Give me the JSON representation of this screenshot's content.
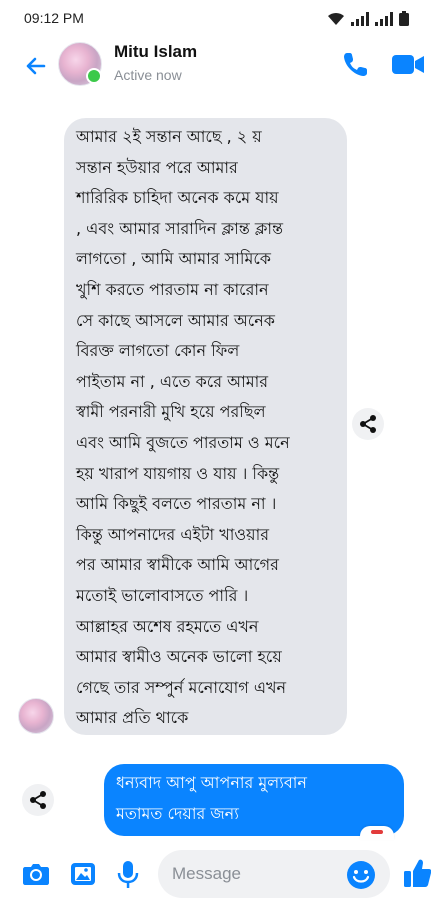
{
  "status_bar": {
    "time": "09:12 PM"
  },
  "header": {
    "contact_name": "Mitu Islam",
    "status": "Active now"
  },
  "messages": {
    "received_text": "আমার ২ই সন্তান আছে , ২ য়\nসন্তান হউয়ার পরে আমার\nশারিরিক চাহিদা অনেক কমে যায়\n, এবং আমার সারাদিন ক্লান্ত ক্লান্ত\nলাগতো , আমি আমার সামিকে\nখুশি করতে পারতাম না কারোন\nসে কাছে আসলে আমার অনেক\nবিরক্ত লাগতো কোন ফিল\nপাইতাম না , এতে করে আমার\nস্বামী পরনারী মুখি হয়ে পরছিল\nএবং আমি বুজতে পারতাম ও মনে\nহয় খারাপ যায়গায় ও যায় । কিন্তু\nআমি কিছুই বলতে পারতাম না ।\nকিন্তু আপনাদের এইটা খাওয়ার\nপর আমার স্বামীকে আমি আগের\nমতোই ভালোবাসতে পারি ।\nআল্লাহর অশেষ রহমতে এখন\nআমার স্বামীও অনেক ভালো হয়ে\nগেছে তার সম্পুর্ন মনোযোগ এখন\nআমার প্রতি থাকে",
    "sent_text": "ধন্যবাদ আপু আপনার মুল্যবান\nমতামত দেয়ার জন্য"
  },
  "composer": {
    "placeholder": "Message"
  },
  "icons": {
    "back": "back-arrow-icon",
    "call": "phone-icon",
    "video": "video-camera-icon",
    "share": "share-icon",
    "camera": "camera-icon",
    "gallery": "gallery-icon",
    "mic": "microphone-icon",
    "emoji": "emoji-icon",
    "like": "thumbs-up-icon"
  },
  "colors": {
    "accent": "#0a84ff",
    "received_bubble": "#e4e6eb",
    "online": "#3cc94a"
  }
}
